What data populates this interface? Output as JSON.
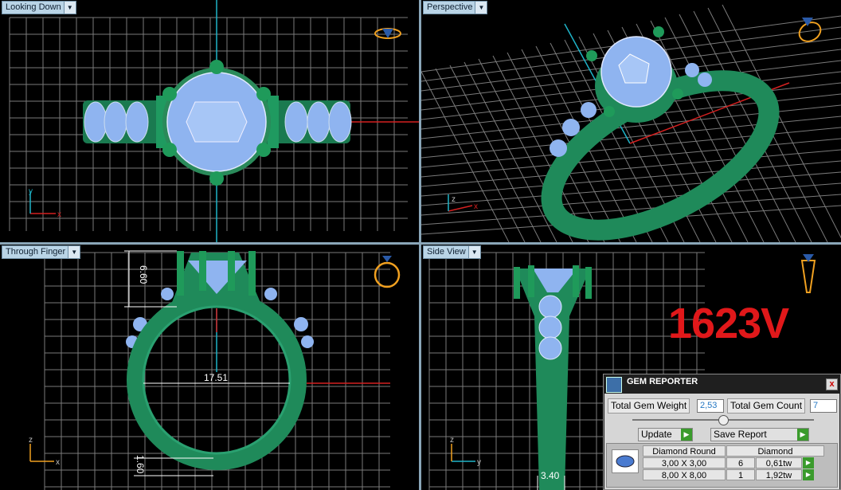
{
  "viewports": {
    "top_left": {
      "label": "Looking Down"
    },
    "top_right": {
      "label": "Perspective"
    },
    "bottom_left": {
      "label": "Through Finger",
      "dims": {
        "height": "6.60",
        "inner": "17.51",
        "band": "1.60"
      }
    },
    "bottom_right": {
      "label": "Side View",
      "dims": {
        "width": "3.40"
      }
    }
  },
  "axes": {
    "x": "x",
    "y": "y",
    "z": "z"
  },
  "watermark": "1623V",
  "gem_reporter": {
    "title": "GEM REPORTER",
    "close_glyph": "x",
    "total_weight_label": "Total Gem Weight",
    "total_weight_value": "2,53",
    "total_count_label": "Total Gem Count",
    "total_count_value": "7",
    "update_label": "Update",
    "save_label": "Save Report",
    "table": {
      "col_type": "Diamond Round",
      "col_material": "Diamond",
      "rows": [
        {
          "size": "3,00 X 3,00",
          "count": "6",
          "weight": "0,61tw"
        },
        {
          "size": "8,00 X 8,00",
          "count": "1",
          "weight": "1,92tw"
        }
      ]
    }
  },
  "colors": {
    "metal": "#1f8a5a",
    "gem": "#8fb4f0",
    "grid": "#8a8a8a",
    "axis_red": "#d42020",
    "axis_cyan": "#1fb4c8"
  }
}
